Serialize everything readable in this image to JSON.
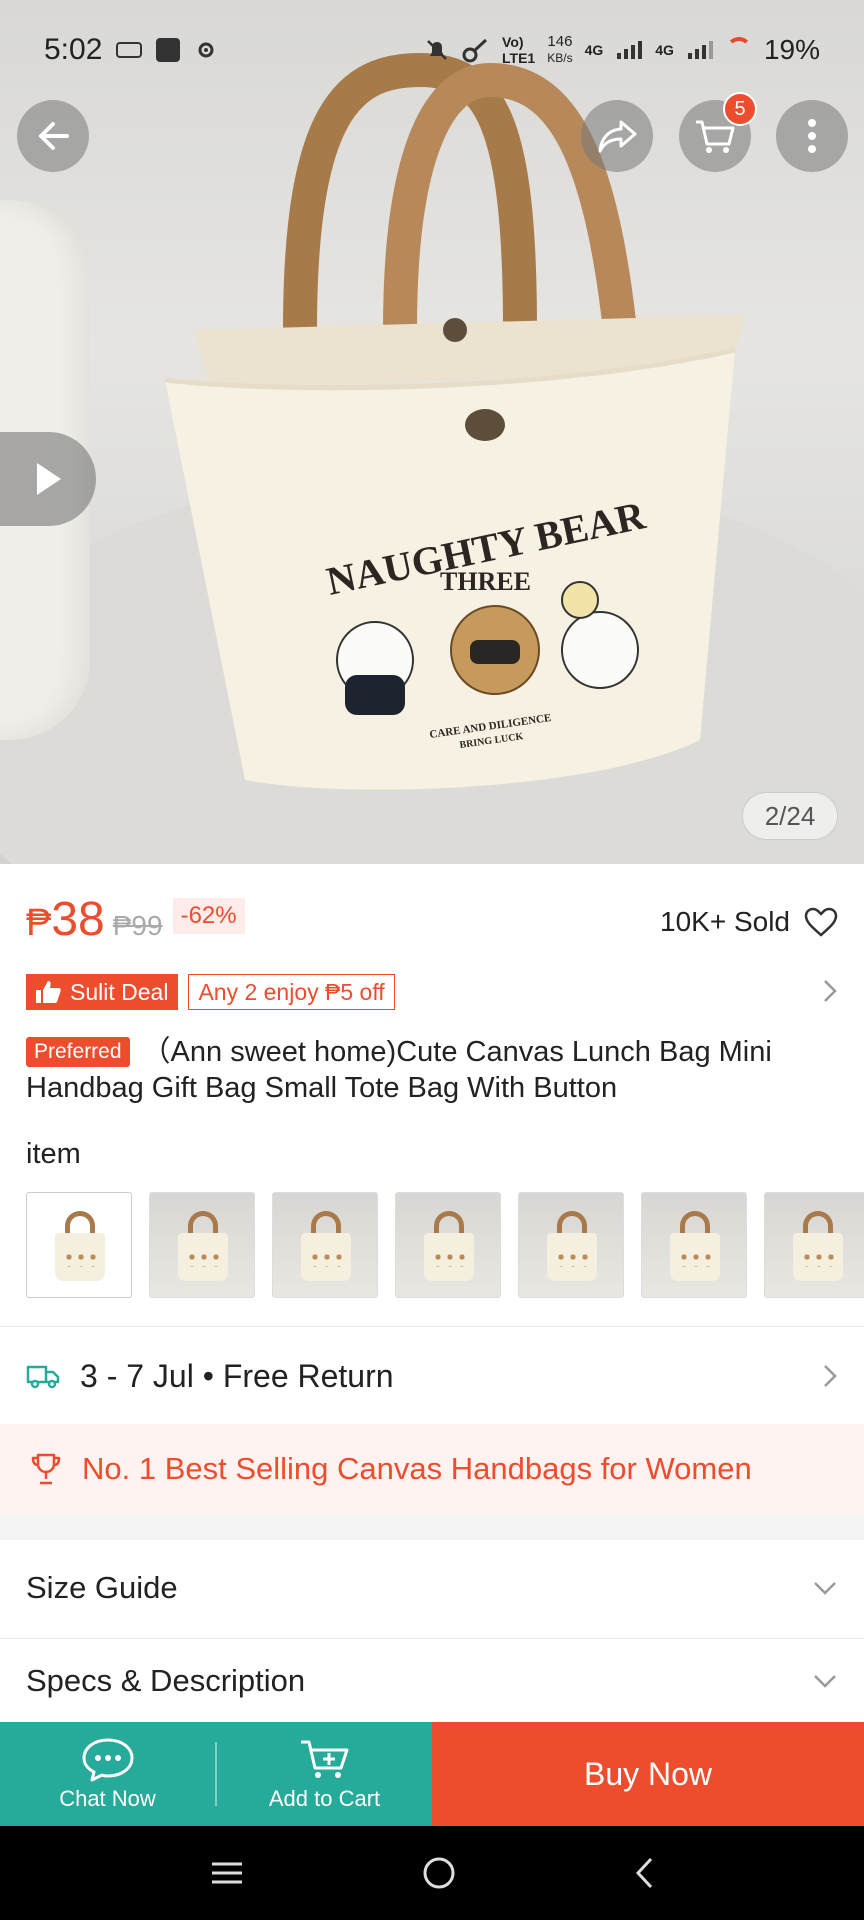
{
  "status_bar": {
    "time": "5:02",
    "net_line1": "146",
    "net_line2": "KB/s",
    "volte": "LTE1",
    "sig1": "4G",
    "sig2": "4G",
    "battery": "19%"
  },
  "header": {
    "cart_count": "5"
  },
  "gallery": {
    "counter": "2/24",
    "print_line1": "NAUGHTY BEAR",
    "print_line2": "THREE",
    "print_line3": "CARE AND DILIGENCE",
    "print_line4": "BRING LUCK"
  },
  "price": {
    "currency": "₱",
    "current": "38",
    "original": "₱99",
    "discount": "-62%",
    "sold": "10K+ Sold"
  },
  "deals": {
    "sulit_label": "Sulit Deal",
    "coupon": "Any 2 enjoy ₱5 off"
  },
  "product": {
    "badge": "Preferred",
    "title": "（Ann sweet home)Cute Canvas Lunch Bag Mini Handbag Gift Bag Small Tote Bag With Button",
    "title_extra": "item"
  },
  "delivery": {
    "text": "3 - 7 Jul • Free Return"
  },
  "banner": {
    "text": "No. 1 Best Selling Canvas Handbags for Women"
  },
  "sections": {
    "size_guide": "Size Guide",
    "specs": "Specs & Description"
  },
  "bottom_bar": {
    "chat": "Chat Now",
    "add_to_cart": "Add to Cart",
    "buy_now": "Buy Now"
  },
  "colors": {
    "accent": "#ee4d2d",
    "teal": "#26aa99"
  }
}
